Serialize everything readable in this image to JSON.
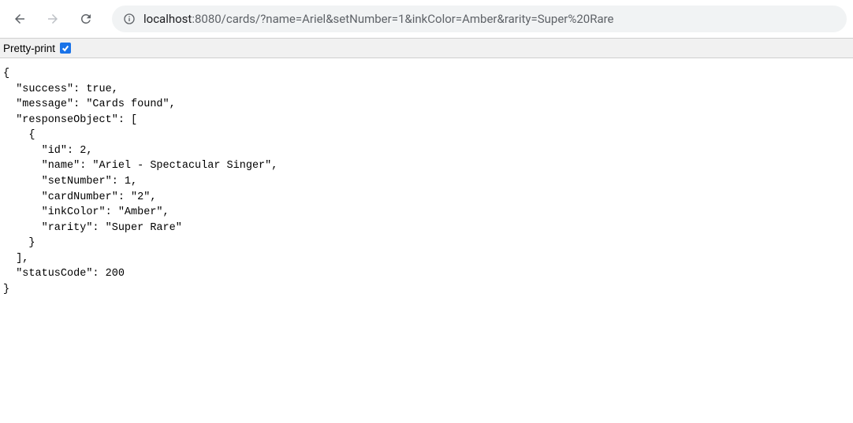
{
  "toolbar": {
    "url_host": "localhost",
    "url_rest": ":8080/cards/?name=Ariel&setNumber=1&inkColor=Amber&rarity=Super%20Rare"
  },
  "pretty_print": {
    "label": "Pretty-print",
    "checked": true
  },
  "response": {
    "success": true,
    "message": "Cards found",
    "responseObject": [
      {
        "id": 2,
        "name": "Ariel - Spectacular Singer",
        "setNumber": 1,
        "cardNumber": "2",
        "inkColor": "Amber",
        "rarity": "Super Rare"
      }
    ],
    "statusCode": 200
  }
}
